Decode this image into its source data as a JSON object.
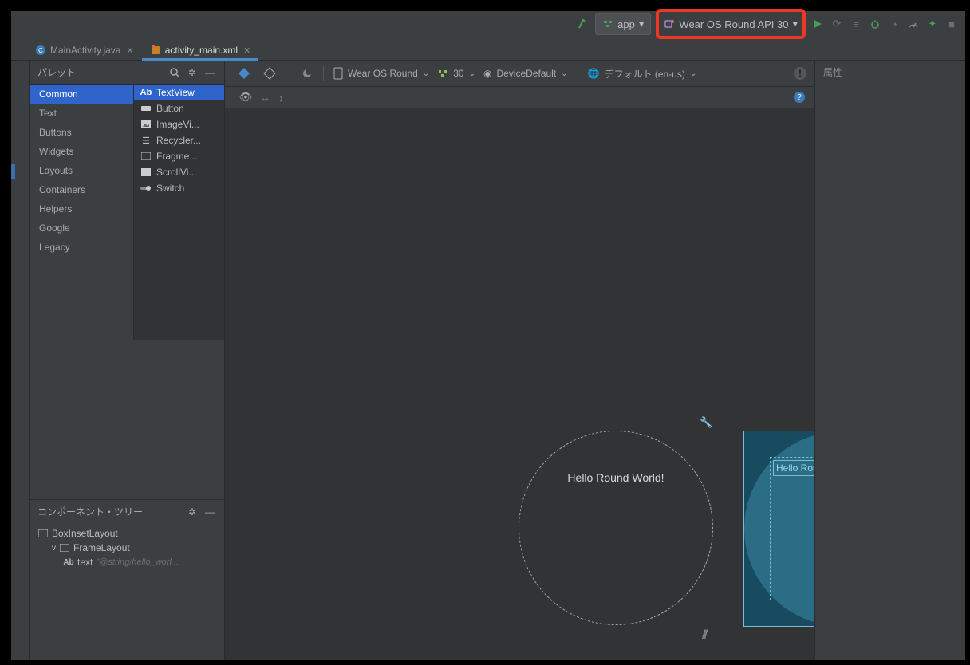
{
  "toolbar": {
    "module": "app",
    "device": "Wear OS Round API 30"
  },
  "tabs": [
    {
      "label": "MainActivity.java",
      "active": false,
      "icon": "java"
    },
    {
      "label": "activity_main.xml",
      "active": true,
      "icon": "xml"
    }
  ],
  "palette": {
    "title": "パレット",
    "categories": [
      "Common",
      "Text",
      "Buttons",
      "Widgets",
      "Layouts",
      "Containers",
      "Helpers",
      "Google",
      "Legacy"
    ],
    "selected": "Common",
    "widgets": [
      {
        "label": "TextView",
        "icon": "Ab",
        "selected": true
      },
      {
        "label": "Button",
        "icon": "box"
      },
      {
        "label": "ImageVi...",
        "icon": "image"
      },
      {
        "label": "Recycler...",
        "icon": "list"
      },
      {
        "label": "Fragme...",
        "icon": "frame"
      },
      {
        "label": "ScrollVi...",
        "icon": "box"
      },
      {
        "label": "Switch",
        "icon": "switch"
      }
    ]
  },
  "componentTree": {
    "title": "コンポーネント・ツリー",
    "nodes": [
      {
        "label": "BoxInsetLayout",
        "level": 0,
        "icon": "frame",
        "expand": ""
      },
      {
        "label": "FrameLayout",
        "level": 1,
        "icon": "frame",
        "expand": "v"
      },
      {
        "label": "text",
        "level": 2,
        "icon": "Ab",
        "ref": "\"@string/hello_worl..."
      }
    ]
  },
  "designToolbar": {
    "device": "Wear OS Round",
    "api": "30",
    "theme": "DeviceDefault",
    "locale": "デフォルト (en-us)"
  },
  "canvas": {
    "previewText": "Hello Round World!",
    "blueprintText": "Hello Round World!"
  },
  "attributes": {
    "title": "属性"
  }
}
